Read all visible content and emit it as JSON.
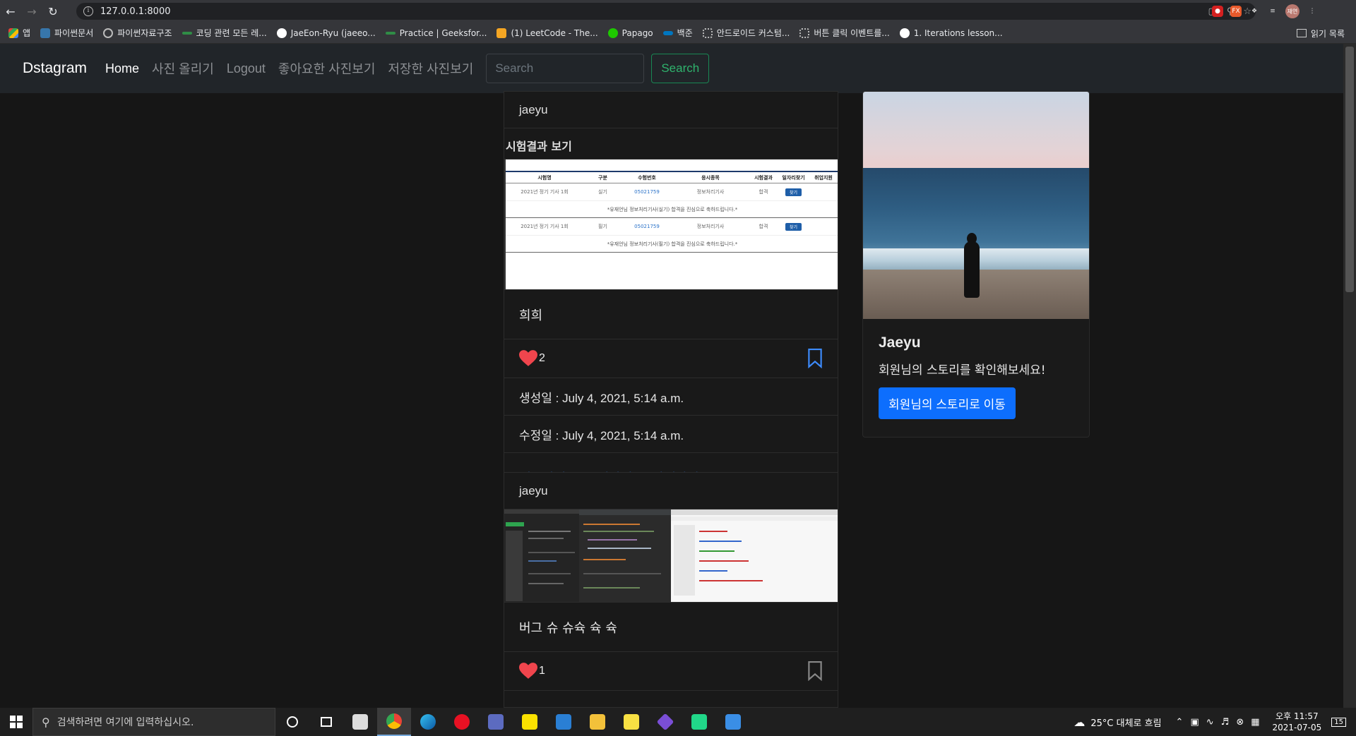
{
  "browser": {
    "url": "127.0.0.1:8000",
    "profile_label": "재연",
    "bookmarks": [
      {
        "label": "앱",
        "color": "#e94235"
      },
      {
        "label": "파이썬문서",
        "color": "#3776ab"
      },
      {
        "label": "파이썬자료구조",
        "color": "#bbbbbb"
      },
      {
        "label": "코딩 관련 모든 레...",
        "color": "#2f8d46"
      },
      {
        "label": "JaeEon-Ryu (jaeeo...",
        "color": "#ffffff"
      },
      {
        "label": "Practice | Geeksfor...",
        "color": "#2f8d46"
      },
      {
        "label": "(1) LeetCode - The...",
        "color": "#f5a623"
      },
      {
        "label": "Papago",
        "color": "#1ec800"
      },
      {
        "label": "백준",
        "color": "#0076c0"
      },
      {
        "label": "안드로이드 커스텀...",
        "color": "#999999"
      },
      {
        "label": "버튼 클릭 이벤트를...",
        "color": "#999999"
      },
      {
        "label": "1. Iterations lesson...",
        "color": "#ffffff"
      }
    ],
    "reading_list": "읽기 목록"
  },
  "navbar": {
    "brand": "Dstagram",
    "links": [
      "Home",
      "사진 올리기",
      "Logout",
      "좋아요한 사진보기",
      "저장한 사진보기"
    ],
    "search_placeholder": "Search",
    "search_button": "Search"
  },
  "posts": [
    {
      "author": "jaeyu",
      "image_title": "시험결과 보기",
      "exam": {
        "headers": [
          "시험명",
          "구분",
          "수험번호",
          "응시종목",
          "시험결과",
          "일자리찾기",
          "취업지원"
        ],
        "rows": [
          {
            "name": "2021년 정기 기사 1회",
            "type": "실기",
            "number": "05021759",
            "subject": "정보처리기사",
            "result": "합격",
            "btn": "찾기",
            "note": "*유재언님 정보처리기사(실기) 합격을 진심으로 축하드립니다.*"
          },
          {
            "name": "2021년 정기 기사 1회",
            "type": "필기",
            "number": "05021759",
            "subject": "정보처리기사",
            "result": "합격",
            "btn": "찾기",
            "note": "*유재언님 정보처리기사(필기) 합격을 진심으로 축하드립니다.*"
          }
        ]
      },
      "content": "희희",
      "likes": "2",
      "created": "생성일 : July 4, 2021, 5:14 a.m.",
      "updated": "수정일 : July 4, 2021, 5:14 a.m.",
      "actions": [
        "댓글달기",
        "수정하기",
        "삭제하기"
      ]
    },
    {
      "author": "jaeyu",
      "content": "버그 슈 슈슉 슉 슉",
      "likes": "1"
    }
  ],
  "sidebar": {
    "name": "Jaeyu",
    "text": "회원님의 스토리를 확인해보세요!",
    "button": "회원님의 스토리로 이동"
  },
  "taskbar": {
    "search_placeholder": "검색하려면 여기에 입력하십시오.",
    "weather": "25°C  대체로 흐림",
    "time": "오후 11:57",
    "date": "2021-07-05",
    "notifications": "15"
  }
}
